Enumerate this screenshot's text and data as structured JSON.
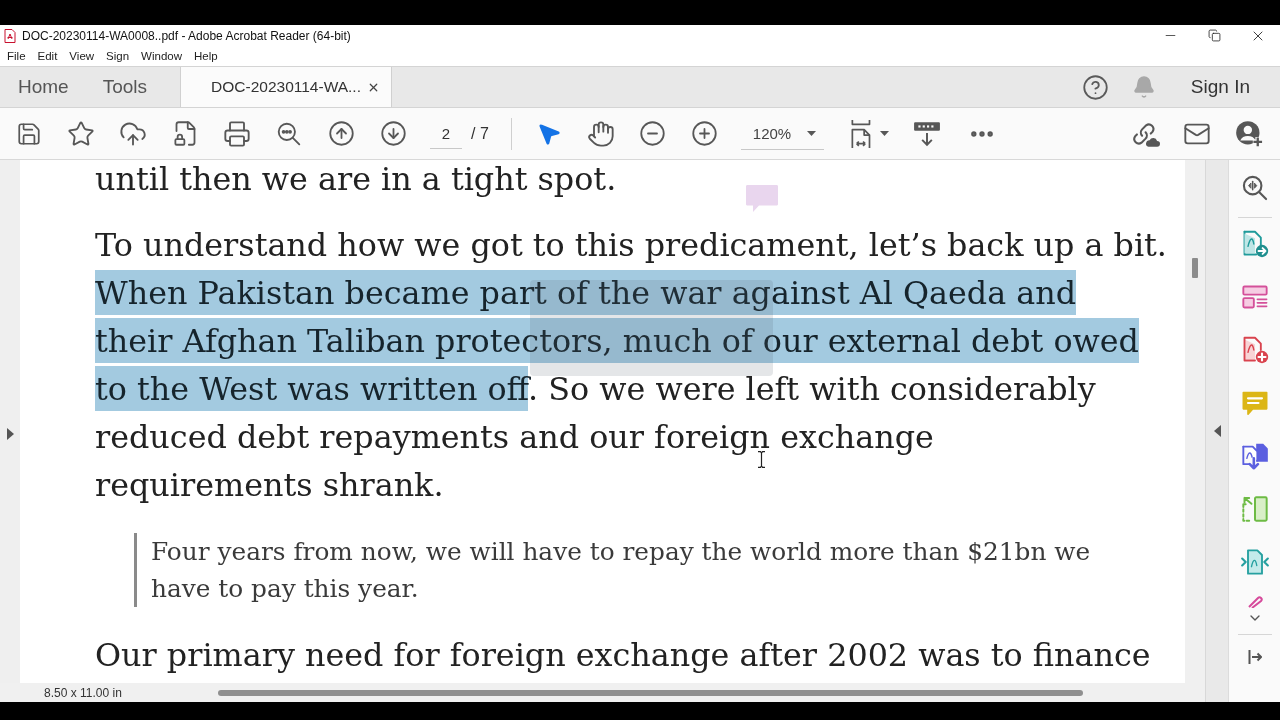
{
  "window": {
    "title": "DOC-20230114-WA0008..pdf - Adobe Acrobat Reader (64-bit)"
  },
  "menu": [
    "File",
    "Edit",
    "View",
    "Sign",
    "Window",
    "Help"
  ],
  "tabs": [
    {
      "label": "Home",
      "kind": "nav",
      "selected": false
    },
    {
      "label": "Tools",
      "kind": "nav",
      "selected": false
    },
    {
      "label": "DOC-20230114-WA...",
      "kind": "document",
      "selected": true
    }
  ],
  "account": {
    "sign_in": "Sign In"
  },
  "toolbar": {
    "page": {
      "value": "2",
      "total": "/ 7"
    },
    "tools": [
      {
        "kind": "select",
        "selected": true
      },
      {
        "kind": "hand",
        "selected": false
      }
    ],
    "zoom": {
      "value": "120%"
    }
  },
  "document": {
    "paragraphs": [
      {
        "kind": "body",
        "lines": [
          [
            {
              "text": "until then we are in a tight spot.",
              "selected": false
            }
          ]
        ]
      },
      {
        "kind": "body",
        "lines": [
          [
            {
              "text": "To understand how we got to this predicament, let’s back up a bit.",
              "selected": false
            }
          ],
          [
            {
              "text": "When Pakistan became part of the war against Al Qaeda and",
              "selected": true
            }
          ],
          [
            {
              "text": "their Afghan Taliban protectors, much of our external debt owed",
              "selected": true
            }
          ],
          [
            {
              "text": "to the West was written off",
              "selected": true
            },
            {
              "text": ". So we were left with considerably",
              "selected": false
            }
          ],
          [
            {
              "text": "reduced debt repayments and our foreign exchange",
              "selected": false
            }
          ],
          [
            {
              "text": "requirements shrank.",
              "selected": false
            }
          ]
        ]
      },
      {
        "kind": "quote",
        "lines": [
          [
            {
              "text": "Four years from now, we will have to repay the world more than $21bn we",
              "selected": false
            }
          ],
          [
            {
              "text": "have to pay this year.",
              "selected": false
            }
          ]
        ]
      },
      {
        "kind": "body",
        "lines": [
          [
            {
              "text": "Our primary need for foreign exchange after 2002 was to finance",
              "selected": false
            }
          ]
        ]
      }
    ]
  },
  "status_bar": {
    "page_size": "8.50 x 11.00 in"
  }
}
